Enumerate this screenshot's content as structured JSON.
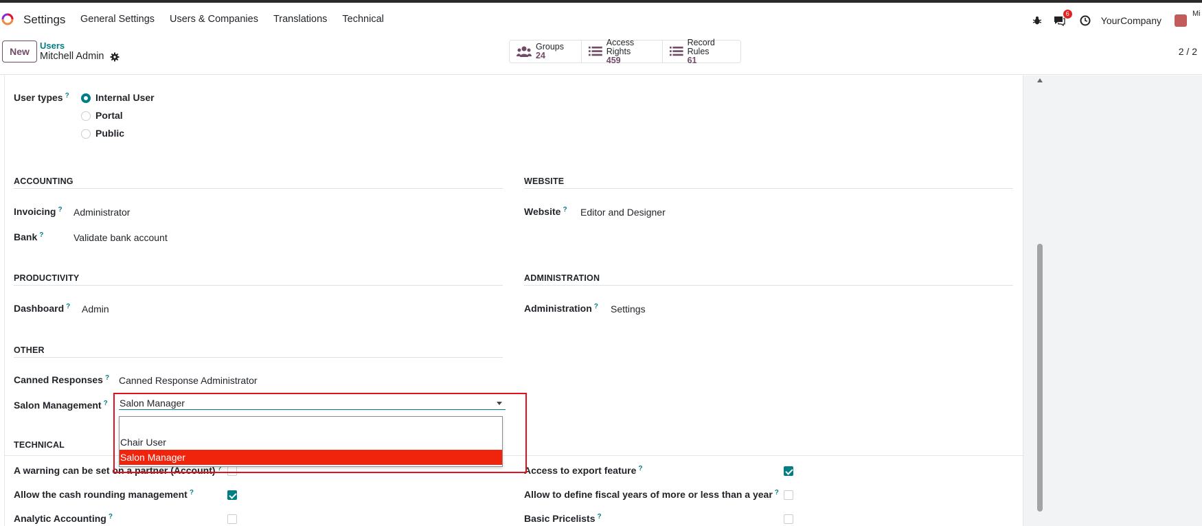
{
  "navbar": {
    "app_name": "Settings",
    "menu": [
      "General Settings",
      "Users & Companies",
      "Translations",
      "Technical"
    ],
    "chat_badge": "6",
    "company": "YourCompany",
    "user_initials": "Mi"
  },
  "control_panel": {
    "new_label": "New",
    "breadcrumb_parent": "Users",
    "breadcrumb_current": "Mitchell Admin",
    "smart_buttons": [
      {
        "label": "Groups",
        "value": "24"
      },
      {
        "label": "Access Rights",
        "value": "459"
      },
      {
        "label": "Record Rules",
        "value": "61"
      }
    ],
    "pager": "2 / 2"
  },
  "form": {
    "user_types": {
      "label": "User types",
      "options": [
        "Internal User",
        "Portal",
        "Public"
      ],
      "selected": "Internal User"
    },
    "sections": {
      "accounting": "ACCOUNTING",
      "website": "WEBSITE",
      "productivity": "PRODUCTIVITY",
      "administration": "ADMINISTRATION",
      "other": "OTHER",
      "technical": "TECHNICAL"
    },
    "fields": {
      "invoicing": {
        "label": "Invoicing",
        "value": "Administrator"
      },
      "bank": {
        "label": "Bank",
        "value": "Validate bank account"
      },
      "website": {
        "label": "Website",
        "value": "Editor and Designer"
      },
      "dashboard": {
        "label": "Dashboard",
        "value": "Admin"
      },
      "administration": {
        "label": "Administration",
        "value": "Settings"
      },
      "canned": {
        "label": "Canned Responses",
        "value": "Canned Response Administrator"
      },
      "salon": {
        "label": "Salon Management",
        "value": "Salon Manager"
      }
    },
    "salon_options": [
      "",
      "Chair User",
      "Salon Manager"
    ],
    "technical_left": [
      {
        "label": "A warning can be set on a partner (Account)",
        "checked": false
      },
      {
        "label": "Allow the cash rounding management",
        "checked": true
      },
      {
        "label": "Analytic Accounting",
        "checked": false
      }
    ],
    "technical_right": [
      {
        "label": "Access to export feature",
        "checked": true
      },
      {
        "label": "Allow to define fiscal years of more or less than a year",
        "checked": false
      },
      {
        "label": "Basic Pricelists",
        "checked": false
      }
    ],
    "help_mark": "?"
  },
  "colors": {
    "brand": "#714b67",
    "accent": "#017e84",
    "highlight_option": "#f0240c",
    "annotation_box": "#e0101c"
  }
}
